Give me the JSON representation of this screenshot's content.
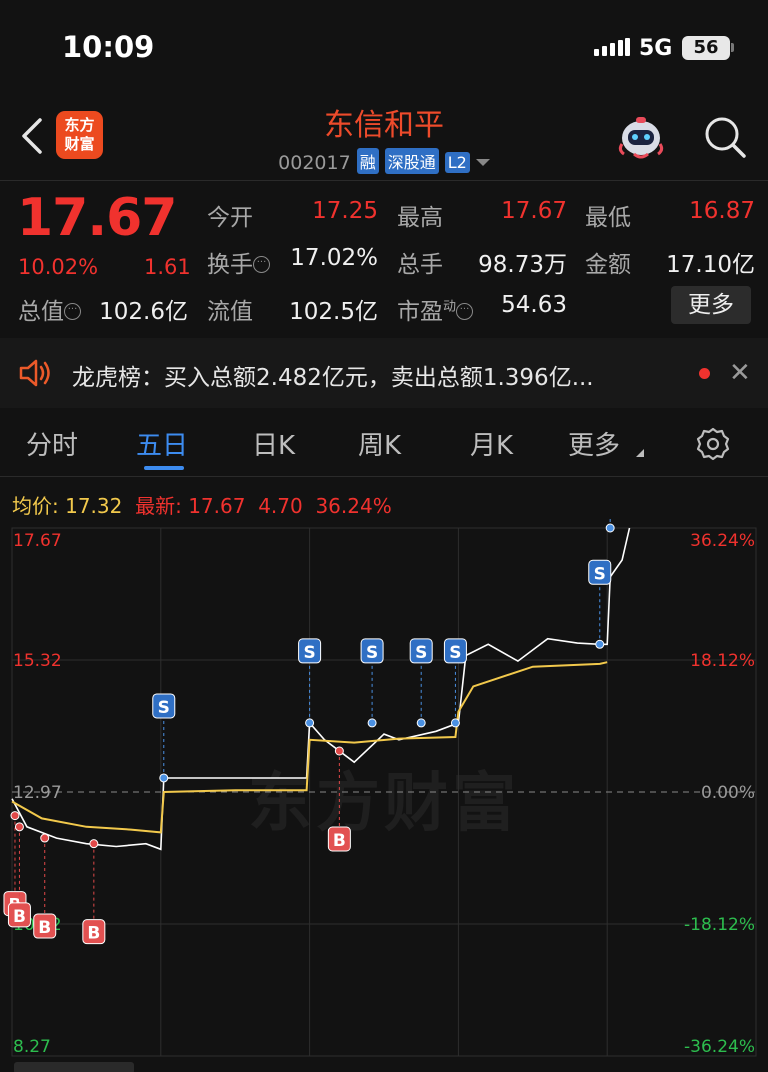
{
  "status": {
    "time": "10:09",
    "network": "5G",
    "battery": "56"
  },
  "header": {
    "logo_line1": "东方",
    "logo_line2": "财富",
    "name": "东信和平",
    "code": "002017",
    "badges": [
      "融",
      "深股通",
      "L2"
    ]
  },
  "quote": {
    "price": "17.67",
    "change_pct": "10.02%",
    "change": "1.61",
    "rows": [
      [
        {
          "label": "今开",
          "value": "17.25",
          "color": "red"
        },
        {
          "label": "最高",
          "value": "17.67",
          "color": "red"
        },
        {
          "label": "最低",
          "value": "16.87",
          "color": "red"
        }
      ],
      [
        {
          "label": "换手",
          "value": "17.02%",
          "color": "white"
        },
        {
          "label": "总手",
          "value": "98.73万",
          "color": "white"
        },
        {
          "label": "金额",
          "value": "17.10亿",
          "color": "white"
        }
      ],
      [
        {
          "label": "总值",
          "value": "102.6亿",
          "color": "white"
        },
        {
          "label": "流值",
          "value": "102.5亿",
          "color": "white"
        },
        {
          "label": "市盈",
          "sup": "动",
          "value": "54.63",
          "color": "white"
        }
      ]
    ],
    "more_label": "更多"
  },
  "news": {
    "text": "龙虎榜：买入总额2.482亿元，卖出总额1.396亿..."
  },
  "tabs": [
    {
      "label": "分时",
      "active": false
    },
    {
      "label": "五日",
      "active": true
    },
    {
      "label": "日K",
      "active": false
    },
    {
      "label": "周K",
      "active": false
    },
    {
      "label": "月K",
      "active": false
    },
    {
      "label": "更多",
      "active": false
    }
  ],
  "legend": {
    "avg_label": "均价:",
    "avg_value": "17.32",
    "latest_label": "最新:",
    "latest_value": "17.67",
    "latest_change": "4.70",
    "latest_pct": "36.24%"
  },
  "chart_data": {
    "type": "line",
    "watermark": "东方财富",
    "y_ticks_left": [
      "17.67",
      "15.32",
      "12.97",
      "10.62",
      "8.27"
    ],
    "y_ticks_right": [
      "36.24%",
      "18.12%",
      "0.00%",
      "-18.12%",
      "-36.24%"
    ],
    "ylim": [
      8.27,
      17.67
    ],
    "prev_close": 12.97,
    "days": 5,
    "series": [
      {
        "name": "价格",
        "color": "#ffffff",
        "x": [
          0.0,
          0.1,
          0.3,
          0.5,
          0.7,
          0.9,
          1.0,
          1.02,
          1.4,
          1.6,
          1.98,
          2.0,
          2.1,
          2.3,
          2.5,
          2.6,
          2.85,
          3.0,
          3.05,
          3.2,
          3.4,
          3.6,
          3.8,
          3.95,
          4.0,
          4.02,
          4.1,
          4.15
        ],
        "y": [
          12.85,
          12.35,
          12.15,
          12.05,
          12.0,
          12.05,
          11.95,
          13.22,
          13.22,
          13.22,
          13.22,
          14.2,
          13.9,
          13.5,
          14.0,
          13.9,
          14.05,
          14.2,
          15.4,
          15.6,
          15.3,
          15.7,
          15.62,
          15.6,
          15.6,
          16.8,
          17.1,
          17.67
        ]
      },
      {
        "name": "均价",
        "color": "#f2c94c",
        "x": [
          0.0,
          0.2,
          0.5,
          0.8,
          1.0,
          1.02,
          1.5,
          1.98,
          2.0,
          2.3,
          2.6,
          2.98,
          3.0,
          3.1,
          3.5,
          3.95,
          4.0
        ],
        "y": [
          12.8,
          12.5,
          12.35,
          12.3,
          12.25,
          12.97,
          13.0,
          13.0,
          13.9,
          13.85,
          13.92,
          13.95,
          14.4,
          14.85,
          15.2,
          15.25,
          15.28
        ]
      }
    ],
    "markers": [
      {
        "type": "S",
        "day": 1.02,
        "price": 13.22
      },
      {
        "type": "S",
        "day": 2.0,
        "price": 14.2
      },
      {
        "type": "S",
        "day": 2.42,
        "price": 14.2
      },
      {
        "type": "S",
        "day": 2.75,
        "price": 14.2
      },
      {
        "type": "S",
        "day": 2.98,
        "price": 14.2
      },
      {
        "type": "S",
        "day": 3.95,
        "price": 15.6
      },
      {
        "type": "S",
        "day": 4.02,
        "price": 17.67
      },
      {
        "type": "B",
        "day": 2.2,
        "price": 13.7
      },
      {
        "type": "B",
        "day": 0.02,
        "price": 12.55
      },
      {
        "type": "B",
        "day": 0.05,
        "price": 12.35
      },
      {
        "type": "B",
        "day": 0.22,
        "price": 12.15
      },
      {
        "type": "B",
        "day": 0.55,
        "price": 12.05
      }
    ]
  }
}
